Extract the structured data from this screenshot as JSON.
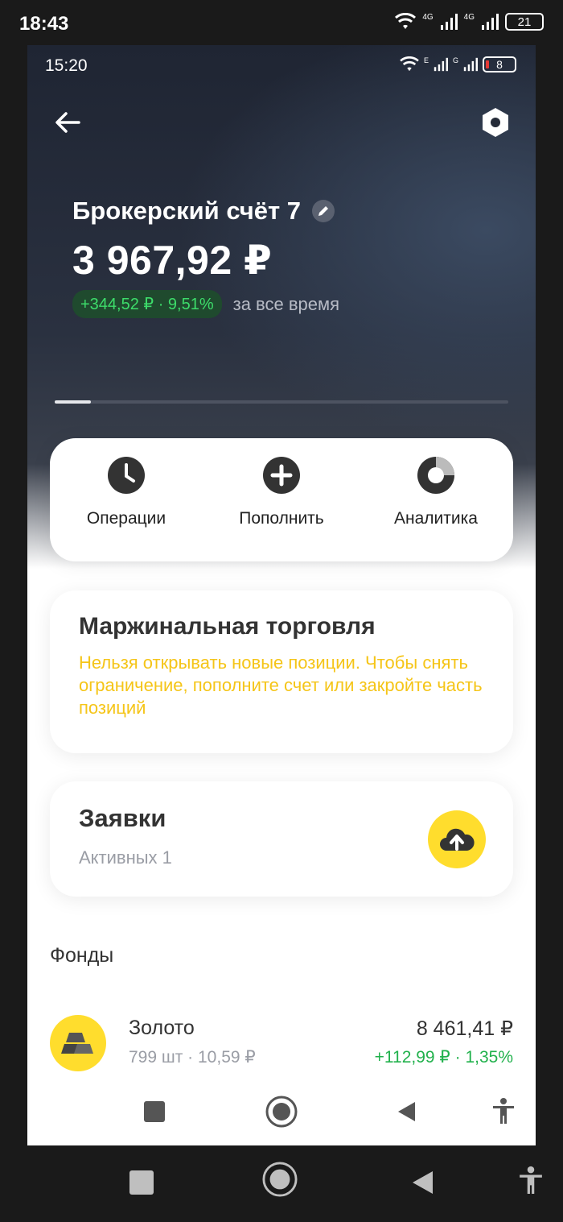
{
  "outer_status": {
    "time": "18:43",
    "battery": "21",
    "net1": "4G",
    "net2": "4G"
  },
  "inner_status": {
    "time": "15:20",
    "battery": "8",
    "net1": "E",
    "net2": "G"
  },
  "header": {
    "back_icon": "arrow-left-icon",
    "settings_icon": "hexagon-settings-icon"
  },
  "account": {
    "name": "Брокерский счёт 7",
    "balance": "3 967,92 ₽",
    "profit": "+344,52 ₽ · 9,51%",
    "period": "за все время",
    "slides_progress": 0.08
  },
  "actions": [
    {
      "label": "Операции",
      "icon": "clock-icon"
    },
    {
      "label": "Пополнить",
      "icon": "plus-circle-icon"
    },
    {
      "label": "Аналитика",
      "icon": "donut-chart-icon"
    }
  ],
  "margin": {
    "title": "Маржинальная торговля",
    "text": "Нельзя открывать новые позиции. Чтобы снять ограничение, пополните счет или закройте часть позиций"
  },
  "orders": {
    "title": "Заявки",
    "subtitle": "Активных 1",
    "icon": "cloud-upload-icon"
  },
  "funds": {
    "title": "Фонды",
    "items": [
      {
        "name": "Золото",
        "sub": "799 шт · 10,59 ₽",
        "value": "8 461,41 ₽",
        "change": "+112,99 ₽ · 1,35%",
        "icon": "gold-bars-icon"
      }
    ]
  },
  "colors": {
    "accent_yellow": "#ffdd2d",
    "profit_green": "#21b14c",
    "warning_yellow": "#f5c518"
  }
}
